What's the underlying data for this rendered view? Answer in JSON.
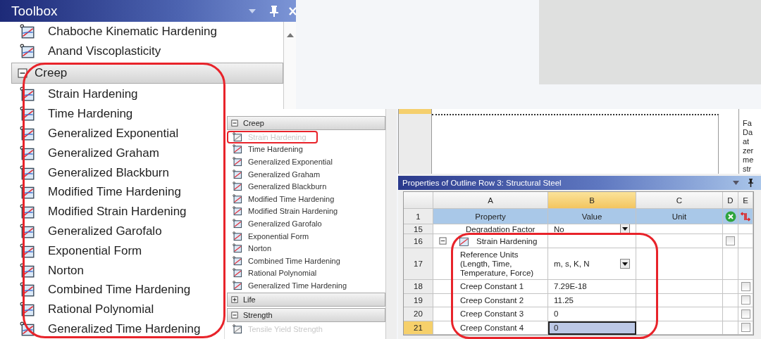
{
  "toolbox": {
    "title": "Toolbox",
    "items": [
      {
        "label": "Chaboche Kinematic Hardening"
      },
      {
        "label": "Anand Viscoplasticity"
      }
    ],
    "groups": [
      {
        "label": "Creep",
        "expanded": true,
        "items": [
          {
            "label": "Strain Hardening"
          },
          {
            "label": "Time Hardening"
          },
          {
            "label": "Generalized Exponential"
          },
          {
            "label": "Generalized Graham"
          },
          {
            "label": "Generalized Blackburn"
          },
          {
            "label": "Modified Time Hardening"
          },
          {
            "label": "Modified Strain Hardening"
          },
          {
            "label": "Generalized Garofalo"
          },
          {
            "label": "Exponential Form"
          },
          {
            "label": "Norton"
          },
          {
            "label": "Combined Time Hardening"
          },
          {
            "label": "Rational Polynomial"
          },
          {
            "label": "Generalized Time Hardening"
          }
        ]
      }
    ]
  },
  "toolbox_detail": {
    "groups": [
      {
        "label": "Creep",
        "expanded": true,
        "items": [
          {
            "label": "Strain Hardening",
            "disabled": true,
            "highlighted": true
          },
          {
            "label": "Time Hardening",
            "disabled": false,
            "highlighted": false
          },
          {
            "label": "Generalized Exponential",
            "disabled": false,
            "highlighted": false
          },
          {
            "label": "Generalized Graham",
            "disabled": false,
            "highlighted": false
          },
          {
            "label": "Generalized Blackburn",
            "disabled": false,
            "highlighted": false
          },
          {
            "label": "Modified Time Hardening",
            "disabled": false,
            "highlighted": false
          },
          {
            "label": "Modified Strain Hardening",
            "disabled": false,
            "highlighted": false
          },
          {
            "label": "Generalized Garofalo",
            "disabled": false,
            "highlighted": false
          },
          {
            "label": "Exponential Form",
            "disabled": false,
            "highlighted": false
          },
          {
            "label": "Norton",
            "disabled": false,
            "highlighted": false
          },
          {
            "label": "Combined Time Hardening",
            "disabled": false,
            "highlighted": false
          },
          {
            "label": "Rational Polynomial",
            "disabled": false,
            "highlighted": false
          },
          {
            "label": "Generalized Time Hardening",
            "disabled": false,
            "highlighted": false
          }
        ]
      },
      {
        "label": "Life",
        "expanded": false
      },
      {
        "label": "Strength",
        "expanded": true,
        "items": [
          {
            "label": "Tensile Yield Strength",
            "disabled": true,
            "highlighted": false
          }
        ]
      }
    ]
  },
  "outline": {
    "note_lines": [
      "Fa",
      "Da",
      "at",
      "zer",
      "me",
      "str"
    ]
  },
  "properties": {
    "title": "Properties of Outline Row 3: Structural Steel",
    "columns": [
      "A",
      "B",
      "C",
      "D",
      "E"
    ],
    "header": {
      "number": "1",
      "cells": [
        "Property",
        "Value",
        "Unit"
      ]
    },
    "rows": [
      {
        "number": "15",
        "kind": "dropdown",
        "property": "Degradation Factor",
        "value": "No",
        "selected": false
      },
      {
        "number": "16",
        "kind": "group",
        "property": "Strain Hardening",
        "expanded": true,
        "checked": false,
        "selected": false
      },
      {
        "number": "17",
        "kind": "dropdown",
        "property": "Reference Units (Length, Time, Temperature, Force)",
        "value": "m, s, K, N",
        "selected": false
      },
      {
        "number": "18",
        "kind": "value",
        "property": "Creep Constant 1",
        "value": "7.29E-18",
        "checked": false,
        "selected": false
      },
      {
        "number": "19",
        "kind": "value",
        "property": "Creep Constant 2",
        "value": "11.25",
        "checked": false,
        "selected": false
      },
      {
        "number": "20",
        "kind": "value",
        "property": "Creep Constant 3",
        "value": "0",
        "checked": false,
        "selected": false
      },
      {
        "number": "21",
        "kind": "value",
        "property": "Creep Constant 4",
        "value": "0",
        "checked": false,
        "selected": true
      }
    ]
  }
}
